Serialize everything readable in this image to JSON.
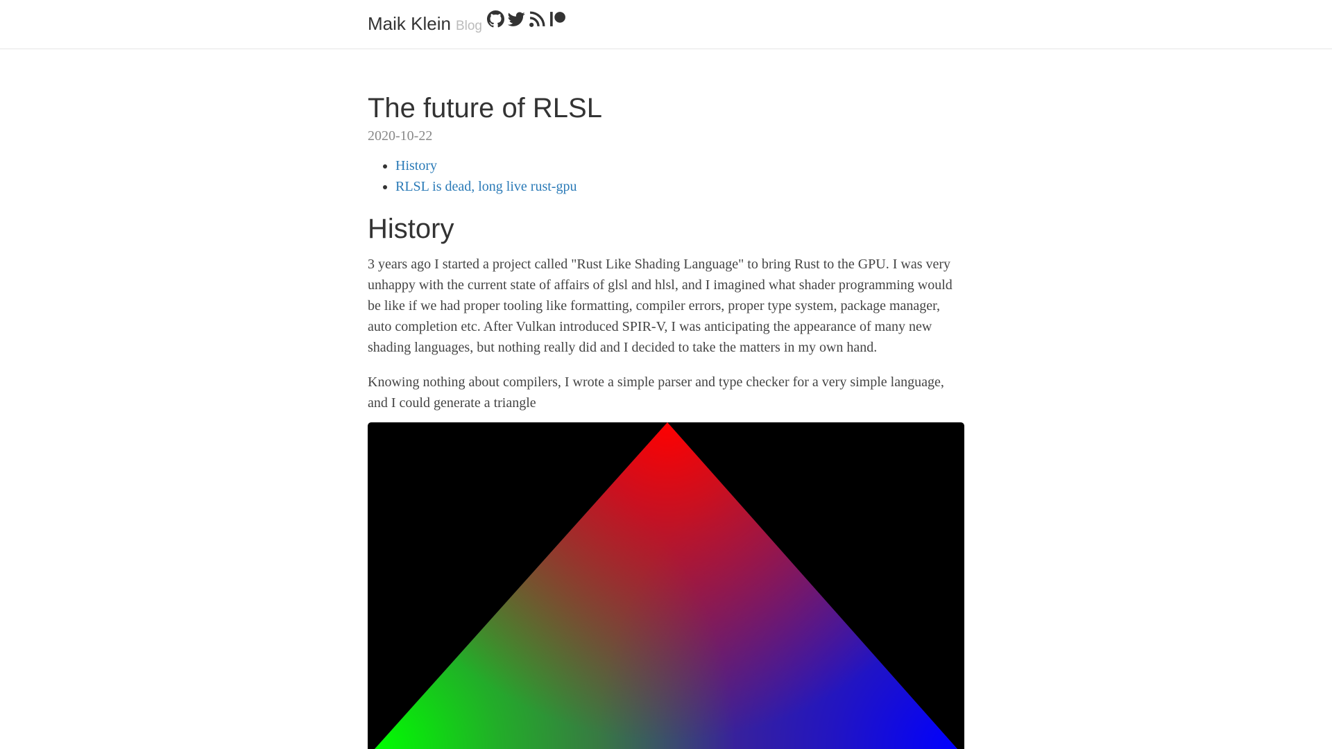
{
  "header": {
    "site_title": "Maik Klein",
    "site_subtitle": "Blog",
    "icons": [
      "github-icon",
      "twitter-icon",
      "rss-icon",
      "patreon-icon"
    ]
  },
  "post": {
    "title": "The future of RLSL",
    "date": "2020-10-22",
    "toc": [
      {
        "label": "History"
      },
      {
        "label": "RLSL is dead, long live rust-gpu"
      }
    ],
    "sections": [
      {
        "heading": "History",
        "paragraphs": [
          "3 years ago I started a project called \"Rust Like Shading Language\" to bring Rust to the GPU. I was very unhappy with the current state of affairs of glsl and hlsl, and I imagined what shader programming would be like if we had proper tooling like formatting, compiler errors, proper type system, package manager, auto completion etc. After Vulkan introduced SPIR-V, I was anticipating the appearance of many new shading languages, but nothing really did and I decided to take the matters in my own hand.",
          "Knowing nothing about compilers, I wrote a simple parser and type checker for a very simple language, and I could generate a triangle"
        ]
      }
    ]
  },
  "colors": {
    "link": "#2a7ab7",
    "text": "#444444",
    "muted": "#888888",
    "subtitle": "#bbbbbb",
    "image_background": "#000000"
  }
}
